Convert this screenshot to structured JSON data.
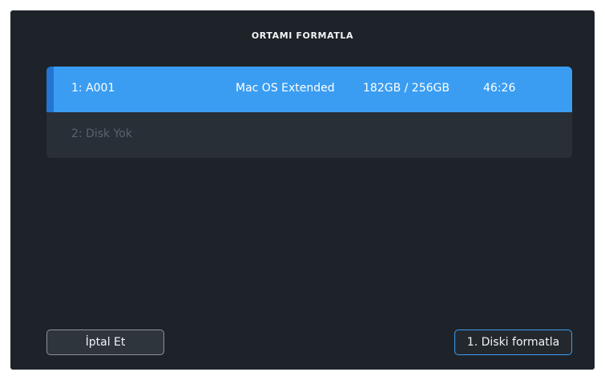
{
  "dialog": {
    "title": "ORTAMI FORMATLA"
  },
  "disks": [
    {
      "name": "1: A001",
      "filesystem": "Mac OS Extended",
      "capacity": "182GB / 256GB",
      "remaining_time": "46:26",
      "selected": true
    },
    {
      "name": "2: Disk Yok",
      "selected": false
    }
  ],
  "buttons": {
    "cancel_label": "İptal Et",
    "format_label": "1. Diski formatla"
  },
  "colors": {
    "background": "#1e2329",
    "list_background": "#292f37",
    "selected_row": "#3a9df2",
    "selected_indicator": "#2375d1",
    "accent_border": "#3a9df2",
    "disabled_text": "#5a626d"
  }
}
